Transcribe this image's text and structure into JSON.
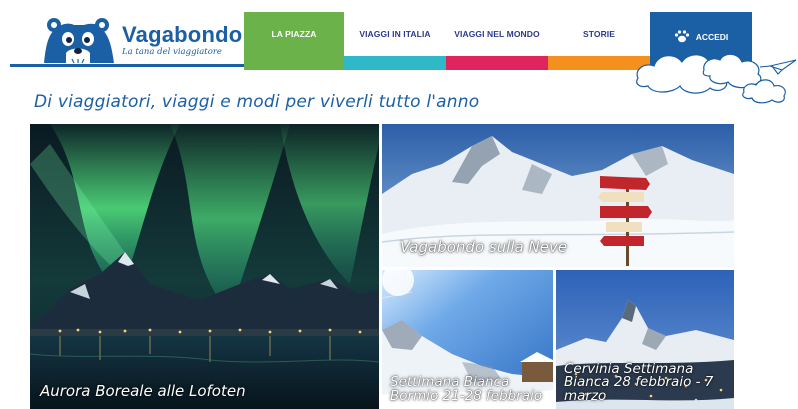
{
  "header": {
    "brand_name": "Vagabondo",
    "brand_tagline": "La tana del viaggiatore",
    "logo_icon": "bear-logo-icon",
    "nav": [
      {
        "label": "LA PIAZZA",
        "color": "#6cb24a",
        "active": true
      },
      {
        "label": "VIAGGI IN ITALIA",
        "color": "#2eb8c8",
        "active": false
      },
      {
        "label": "VIAGGI NEL MONDO",
        "color": "#e0245e",
        "active": false
      },
      {
        "label": "STORIE",
        "color": "#f4901e",
        "active": false
      }
    ],
    "login": {
      "label": "ACCEDI",
      "icon": "paw-icon",
      "color": "#1b5fa4"
    }
  },
  "headline": "Di viaggiatori, viaggi e modi per viverli tutto l'anno",
  "tiles": [
    {
      "caption": "Aurora Boreale alle Lofoten"
    },
    {
      "caption": "Vagabondo sulla Neve"
    },
    {
      "caption": "Settimana Bianca Bormio 21-28 febbraio"
    },
    {
      "caption": "Cervinia Settimana Bianca 28 febbraio - 7 marzo"
    }
  ],
  "colors": {
    "brand_blue": "#1b5fa4",
    "nav_text": "#2b3a8c"
  }
}
